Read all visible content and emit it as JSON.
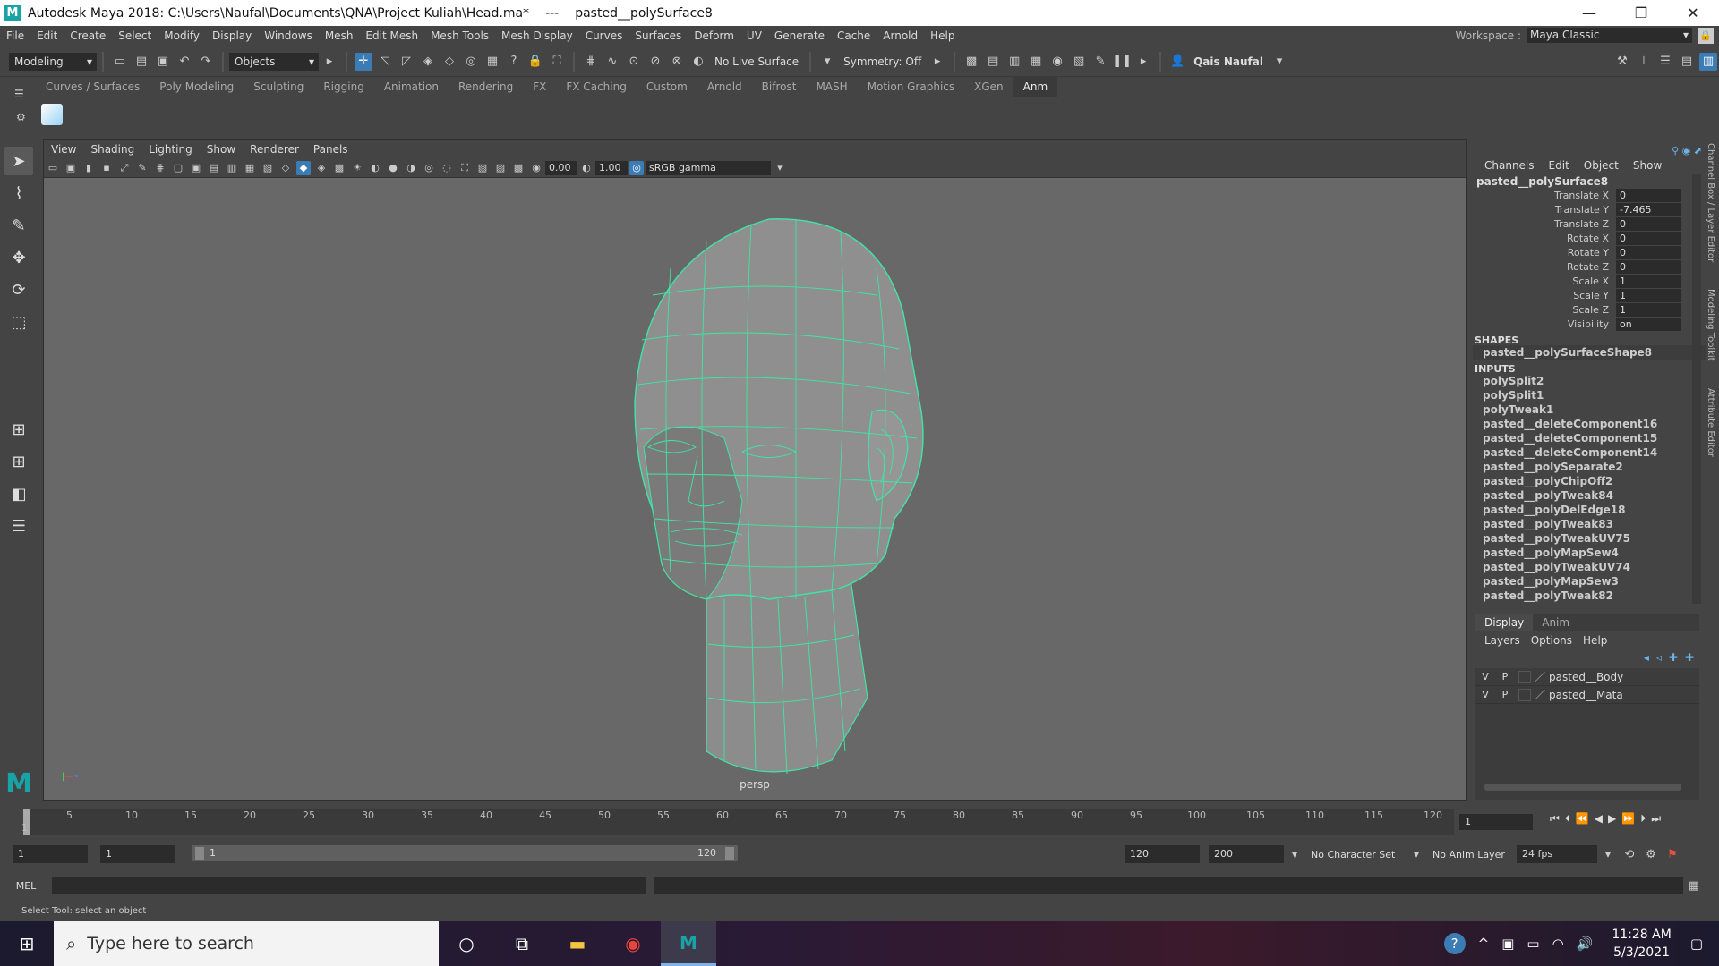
{
  "window": {
    "title": "Autodesk Maya 2018: C:\\Users\\Naufal\\Documents\\QNA\\Project Kuliah\\Head.ma*",
    "separator": "---",
    "selection": "pasted__polySurface8",
    "logo": "M"
  },
  "menubar": {
    "items": [
      "File",
      "Edit",
      "Create",
      "Select",
      "Modify",
      "Display",
      "Windows",
      "Mesh",
      "Edit Mesh",
      "Mesh Tools",
      "Mesh Display",
      "Curves",
      "Surfaces",
      "Deform",
      "UV",
      "Generate",
      "Cache",
      "Arnold",
      "Help"
    ],
    "workspace_label": "Workspace :",
    "workspace_value": "Maya Classic"
  },
  "statusline": {
    "mode": "Modeling",
    "selection_mask": "Objects",
    "live_surface": "No Live Surface",
    "symmetry": "Symmetry: Off",
    "user": "Qais Naufal"
  },
  "shelf": {
    "tabs": [
      "Curves / Surfaces",
      "Poly Modeling",
      "Sculpting",
      "Rigging",
      "Animation",
      "Rendering",
      "FX",
      "FX Caching",
      "Custom",
      "Arnold",
      "Bifrost",
      "MASH",
      "Motion Graphics",
      "XGen",
      "Anm"
    ],
    "active_tab": "Anm"
  },
  "viewport": {
    "menu": [
      "View",
      "Shading",
      "Lighting",
      "Show",
      "Renderer",
      "Panels"
    ],
    "exposure": "0.00",
    "gamma": "1.00",
    "color_space": "sRGB gamma",
    "camera": "persp"
  },
  "channelbox": {
    "menu": [
      "Channels",
      "Edit",
      "Object",
      "Show"
    ],
    "object": "pasted__polySurface8",
    "attributes": [
      {
        "name": "Translate X",
        "value": "0"
      },
      {
        "name": "Translate Y",
        "value": "-7.465"
      },
      {
        "name": "Translate Z",
        "value": "0"
      },
      {
        "name": "Rotate X",
        "value": "0"
      },
      {
        "name": "Rotate Y",
        "value": "0"
      },
      {
        "name": "Rotate Z",
        "value": "0"
      },
      {
        "name": "Scale X",
        "value": "1"
      },
      {
        "name": "Scale Y",
        "value": "1"
      },
      {
        "name": "Scale Z",
        "value": "1"
      },
      {
        "name": "Visibility",
        "value": "on"
      }
    ],
    "shapes_header": "SHAPES",
    "shape": "pasted__polySurfaceShape8",
    "inputs_header": "INPUTS",
    "inputs": [
      "polySplit2",
      "polySplit1",
      "polyTweak1",
      "pasted__deleteComponent16",
      "pasted__deleteComponent15",
      "pasted__deleteComponent14",
      "pasted__polySeparate2",
      "pasted__polyChipOff2",
      "pasted__polyTweak84",
      "pasted__polyDelEdge18",
      "pasted__polyTweak83",
      "pasted__polyTweakUV75",
      "pasted__polyMapSew4",
      "pasted__polyTweakUV74",
      "pasted__polyMapSew3",
      "pasted__polyTweak82"
    ]
  },
  "sidetabs": [
    "Channel Box / Layer Editor",
    "Modeling Toolkit",
    "Attribute Editor"
  ],
  "layereditor": {
    "tabs": [
      "Display",
      "Anim"
    ],
    "menu": [
      "Layers",
      "Options",
      "Help"
    ],
    "layers": [
      {
        "v": "V",
        "p": "P",
        "name": "pasted__Body"
      },
      {
        "v": "V",
        "p": "P",
        "name": "pasted__Mata"
      }
    ]
  },
  "timeline": {
    "ticks": [
      "1",
      "5",
      "10",
      "15",
      "20",
      "25",
      "30",
      "35",
      "40",
      "45",
      "50",
      "55",
      "60",
      "65",
      "70",
      "75",
      "80",
      "85",
      "90",
      "95",
      "100",
      "105",
      "110",
      "115",
      "120"
    ],
    "current_frame": "1"
  },
  "range": {
    "start": "1",
    "playback_start": "1",
    "range_start": "1",
    "range_end": "120",
    "playback_end": "120",
    "end": "200",
    "character_set": "No Character Set",
    "anim_layer": "No Anim Layer",
    "fps": "24 fps"
  },
  "cmdline": {
    "label": "MEL"
  },
  "helpline": "Select Tool: select an object",
  "taskbar": {
    "search_placeholder": "Type here to search",
    "time": "11:28 AM",
    "date": "5/3/2021"
  },
  "colors": {
    "wire": "#3ee6a6",
    "mesh": "#8a8a8a",
    "accent": "#3c7cb5"
  }
}
